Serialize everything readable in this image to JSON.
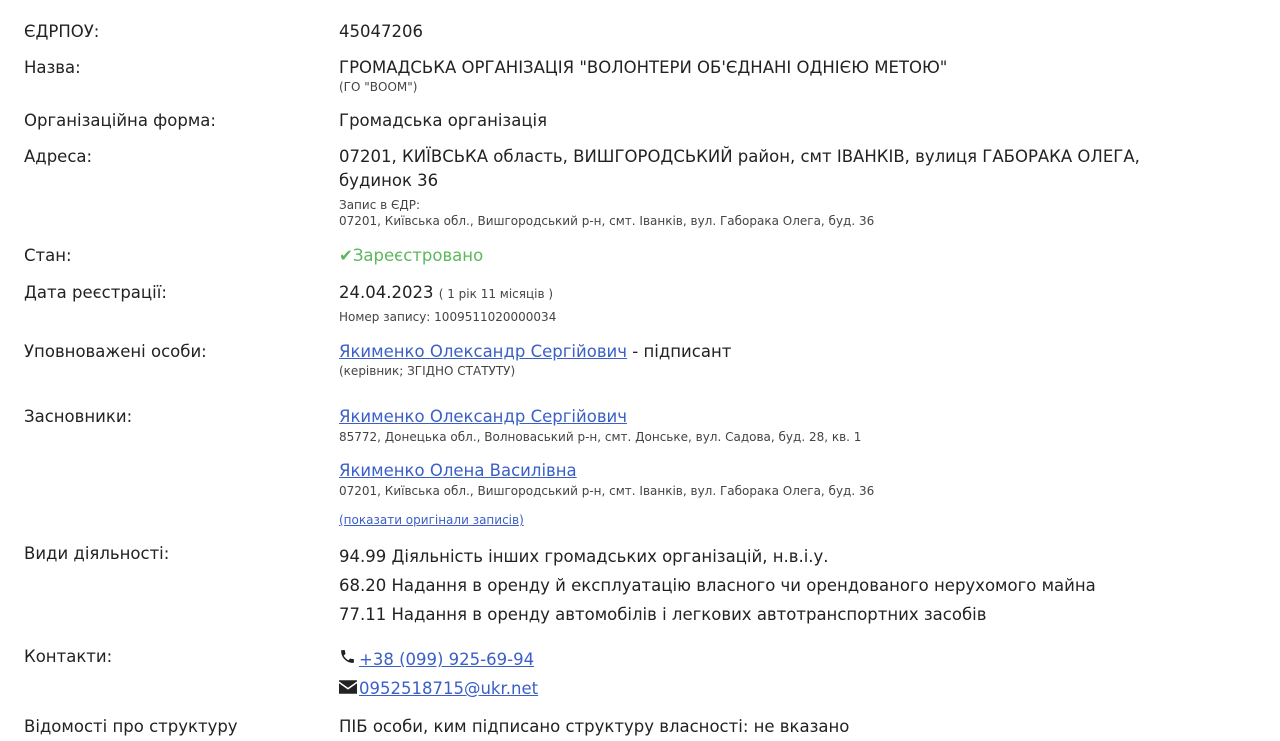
{
  "edrpou": {
    "label": "ЄДРПОУ:",
    "value": "45047206"
  },
  "name": {
    "label": "Назва:",
    "value": "ГРОМАДСЬКА ОРГАНІЗАЦІЯ \"ВОЛОНТЕРИ ОБ'ЄДНАНІ ОДНІЄЮ МЕТОЮ\"",
    "short": "(ГО \"ВООМ\")"
  },
  "org_form": {
    "label": "Організаційна форма:",
    "value": "Громадська організація"
  },
  "address": {
    "label": "Адреса:",
    "line1": "07201, КИЇВСЬКА область, ВИШГОРОДСЬКИЙ район, смт ІВАНКІВ, вулиця ГАБОРАКА ОЛЕГА,",
    "line2": "будинок 36",
    "record_label": "Запис в ЄДР:",
    "record_value": "07201, Київська обл., Вишгородський р-н, смт. Іванків, вул. Габорака Олега, буд. 36"
  },
  "status": {
    "label": "Стан:",
    "icon": "check-icon",
    "value": "Зареєстровано",
    "color": "#5cb85c"
  },
  "registration": {
    "label": "Дата реєстрації:",
    "date": "24.04.2023",
    "age": "( 1 рік 11 місяців )",
    "record_no": "Номер запису: 1009511020000034"
  },
  "authorized": {
    "label": "Уповноважені особи:",
    "person": "Якименко Олександр Сергійович",
    "role": "- підписант",
    "note": "(керівник; ЗГІДНО СТАТУТУ)"
  },
  "founders": {
    "label": "Засновники:",
    "items": [
      {
        "name": "Якименко Олександр Сергійович",
        "address": "85772, Донецька обл., Волноваський р-н, смт. Донське, вул. Садова, буд. 28, кв. 1"
      },
      {
        "name": "Якименко Олена Василівна",
        "address": "07201, Київська обл., Вишгородський р-н, смт. Іванків, вул. Габорака Олега, буд. 36"
      }
    ],
    "show_originals": "(показати оригінали записів)"
  },
  "activities": {
    "label": "Види діяльності:",
    "items": [
      "94.99 Діяльність інших громадських організацій, н.в.і.у.",
      "68.20 Надання в оренду й експлуатацію власного чи орендованого нерухомого майна",
      "77.11 Надання в оренду автомобілів і легкових автотранспортних засобів"
    ]
  },
  "contacts": {
    "label": "Контакти:",
    "phone_icon": "phone-icon",
    "phone": "+38 (099) 925-69-94",
    "email_icon": "envelope-icon",
    "email": "0952518715@ukr.net"
  },
  "structure": {
    "label": "Відомості про структуру",
    "value": "ПІБ особи, ким підписано структуру власності: не вказано"
  },
  "colors": {
    "link": "#3a5fc8",
    "text": "#222222",
    "success": "#5cb85c"
  }
}
